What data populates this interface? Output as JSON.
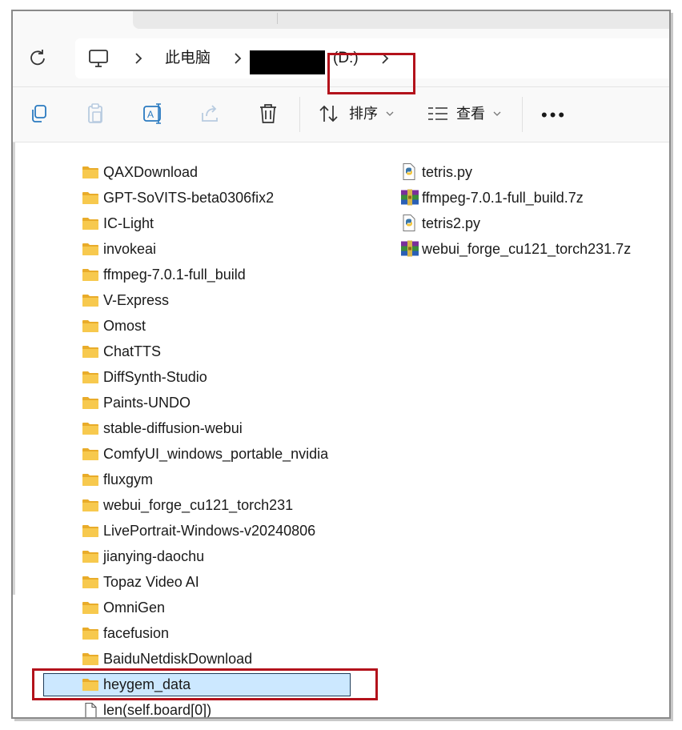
{
  "address": {
    "crumbs": [
      "此电脑",
      "(D:)"
    ],
    "redacted_label": "",
    "refresh_icon": "refresh-icon",
    "computer_icon": "computer-icon"
  },
  "toolbar": {
    "copy_icon": "copy-icon",
    "paste_icon": "paste-icon",
    "rename_icon": "rename-icon",
    "share_icon": "share-icon",
    "delete_icon": "delete-icon",
    "sort_label": "排序",
    "view_label": "查看",
    "more_label": "•••"
  },
  "files": {
    "left": [
      {
        "name": "QAXDownload",
        "type": "folder"
      },
      {
        "name": "GPT-SoVITS-beta0306fix2",
        "type": "folder"
      },
      {
        "name": "IC-Light",
        "type": "folder"
      },
      {
        "name": "invokeai",
        "type": "folder"
      },
      {
        "name": "ffmpeg-7.0.1-full_build",
        "type": "folder"
      },
      {
        "name": "V-Express",
        "type": "folder"
      },
      {
        "name": "Omost",
        "type": "folder"
      },
      {
        "name": "ChatTTS",
        "type": "folder"
      },
      {
        "name": "DiffSynth-Studio",
        "type": "folder"
      },
      {
        "name": "Paints-UNDO",
        "type": "folder"
      },
      {
        "name": "stable-diffusion-webui",
        "type": "folder"
      },
      {
        "name": "ComfyUI_windows_portable_nvidia",
        "type": "folder"
      },
      {
        "name": "fluxgym",
        "type": "folder"
      },
      {
        "name": "webui_forge_cu121_torch231",
        "type": "folder"
      },
      {
        "name": "LivePortrait-Windows-v20240806",
        "type": "folder"
      },
      {
        "name": "jianying-daochu",
        "type": "folder"
      },
      {
        "name": "Topaz Video AI",
        "type": "folder"
      },
      {
        "name": "OmniGen",
        "type": "folder"
      },
      {
        "name": "facefusion",
        "type": "folder"
      },
      {
        "name": "BaiduNetdiskDownload",
        "type": "folder"
      },
      {
        "name": "heygem_data",
        "type": "folder",
        "selected": true
      },
      {
        "name": "len(self.board[0])",
        "type": "file"
      }
    ],
    "right": [
      {
        "name": "tetris.py",
        "type": "python"
      },
      {
        "name": "ffmpeg-7.0.1-full_build.7z",
        "type": "archive"
      },
      {
        "name": "tetris2.py",
        "type": "python"
      },
      {
        "name": "webui_forge_cu121_torch231.7z",
        "type": "archive"
      }
    ]
  },
  "colors": {
    "highlight_box": "#b3121b",
    "selection": "#cce8ff",
    "folder": "#f7c34a"
  }
}
